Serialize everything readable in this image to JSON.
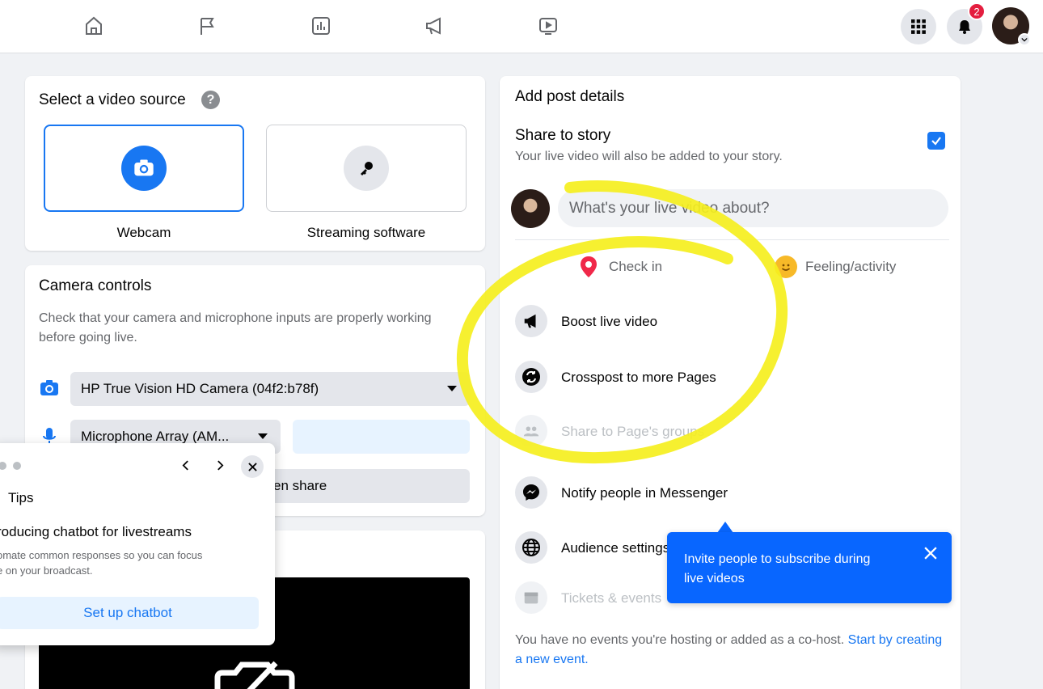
{
  "topnav": {
    "items": [
      {
        "icon": "home-icon"
      },
      {
        "icon": "flag-icon"
      },
      {
        "icon": "insights-icon"
      },
      {
        "icon": "megaphone-icon"
      },
      {
        "icon": "video-icon"
      }
    ],
    "notification_count": "2"
  },
  "video_source": {
    "title": "Select a video source",
    "webcam_label": "Webcam",
    "streaming_label": "Streaming software"
  },
  "camera_controls": {
    "title": "Camera controls",
    "description": "Check that your camera and microphone inputs are properly working before going live.",
    "camera_value": "HP True Vision HD Camera (04f2:b78f)",
    "mic_value": "Microphone Array (AM...",
    "screen_share_label": "en share"
  },
  "tips_popup": {
    "title": "Tips",
    "heading": "roducing chatbot for livestreams",
    "body_line1": "omate common responses so you can focus",
    "body_line2": "e on your broadcast.",
    "button": "Set up chatbot"
  },
  "post_details": {
    "title": "Add post details",
    "share_story_title": "Share to story",
    "share_story_sub": "Your live video will also be added to your story.",
    "share_story_checked": true,
    "composer_placeholder": "What's your live video about?",
    "check_in": "Check in",
    "feeling": "Feeling/activity",
    "boost": "Boost live video",
    "crosspost": "Crosspost to more Pages",
    "share_groups": "Share to Page's groups",
    "notify": "Notify people in Messenger",
    "audience": "Audience settings",
    "tickets": "Tickets & events",
    "events_text": "You have no events you're hosting or added as a co-host.",
    "events_link_1": "Start by",
    "events_link_2": "creating a new event."
  },
  "tooltip": {
    "text_line1": "Invite people to subscribe during",
    "text_line2": "live videos"
  },
  "colors": {
    "accent": "#1877f2",
    "highlight": "#f5ef1e"
  }
}
